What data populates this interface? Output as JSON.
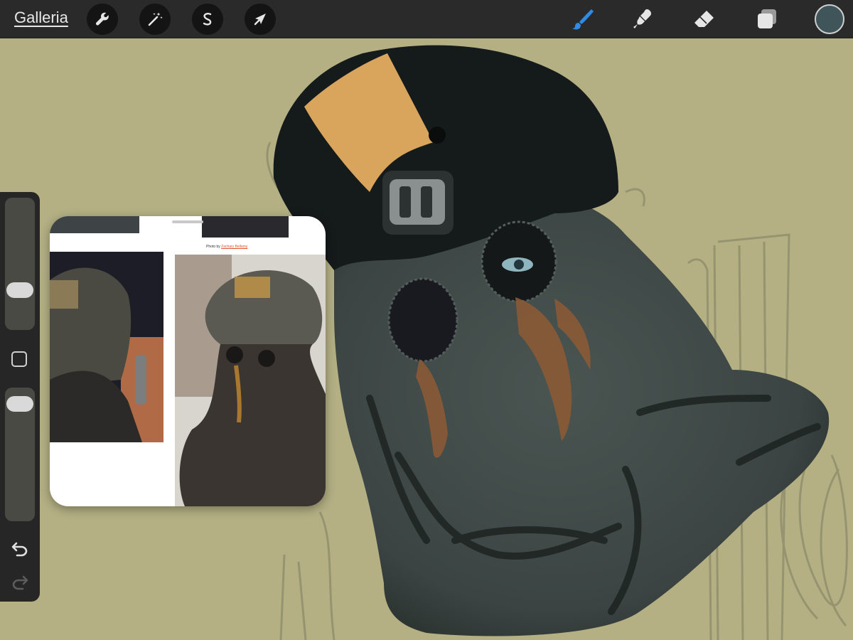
{
  "toolbar": {
    "gallery_label": "Galleria",
    "left_tools": [
      {
        "name": "wrench-icon",
        "tool": "actions"
      },
      {
        "name": "magic-wand-icon",
        "tool": "adjustments"
      },
      {
        "name": "selection-icon",
        "tool": "selection"
      },
      {
        "name": "arrow-cursor-icon",
        "tool": "transform"
      }
    ],
    "right_tools": [
      {
        "name": "brush-icon",
        "tool": "paint",
        "active": true
      },
      {
        "name": "smudge-icon",
        "tool": "smudge",
        "active": false
      },
      {
        "name": "eraser-icon",
        "tool": "eraser",
        "active": false
      },
      {
        "name": "layers-icon",
        "tool": "layers",
        "active": false
      }
    ],
    "current_color": "#3f5559",
    "active_tool_color": "#2f8be6"
  },
  "sidebar": {
    "brush_size_level": 0.26,
    "opacity_level": 0.95,
    "modify_icon": "square-icon",
    "undo_icon": "undo-icon",
    "redo_icon": "redo-icon"
  },
  "reference": {
    "credit_prefix": "Photo by",
    "credit_author": "Zachary Bellamy"
  },
  "colors": {
    "canvas_background": "#b4b084",
    "toolbar_background": "#2a2a2a",
    "hood_main": "#3e4745",
    "helmet_dark": "#151a1a",
    "tan_patch": "#d9a45c"
  }
}
